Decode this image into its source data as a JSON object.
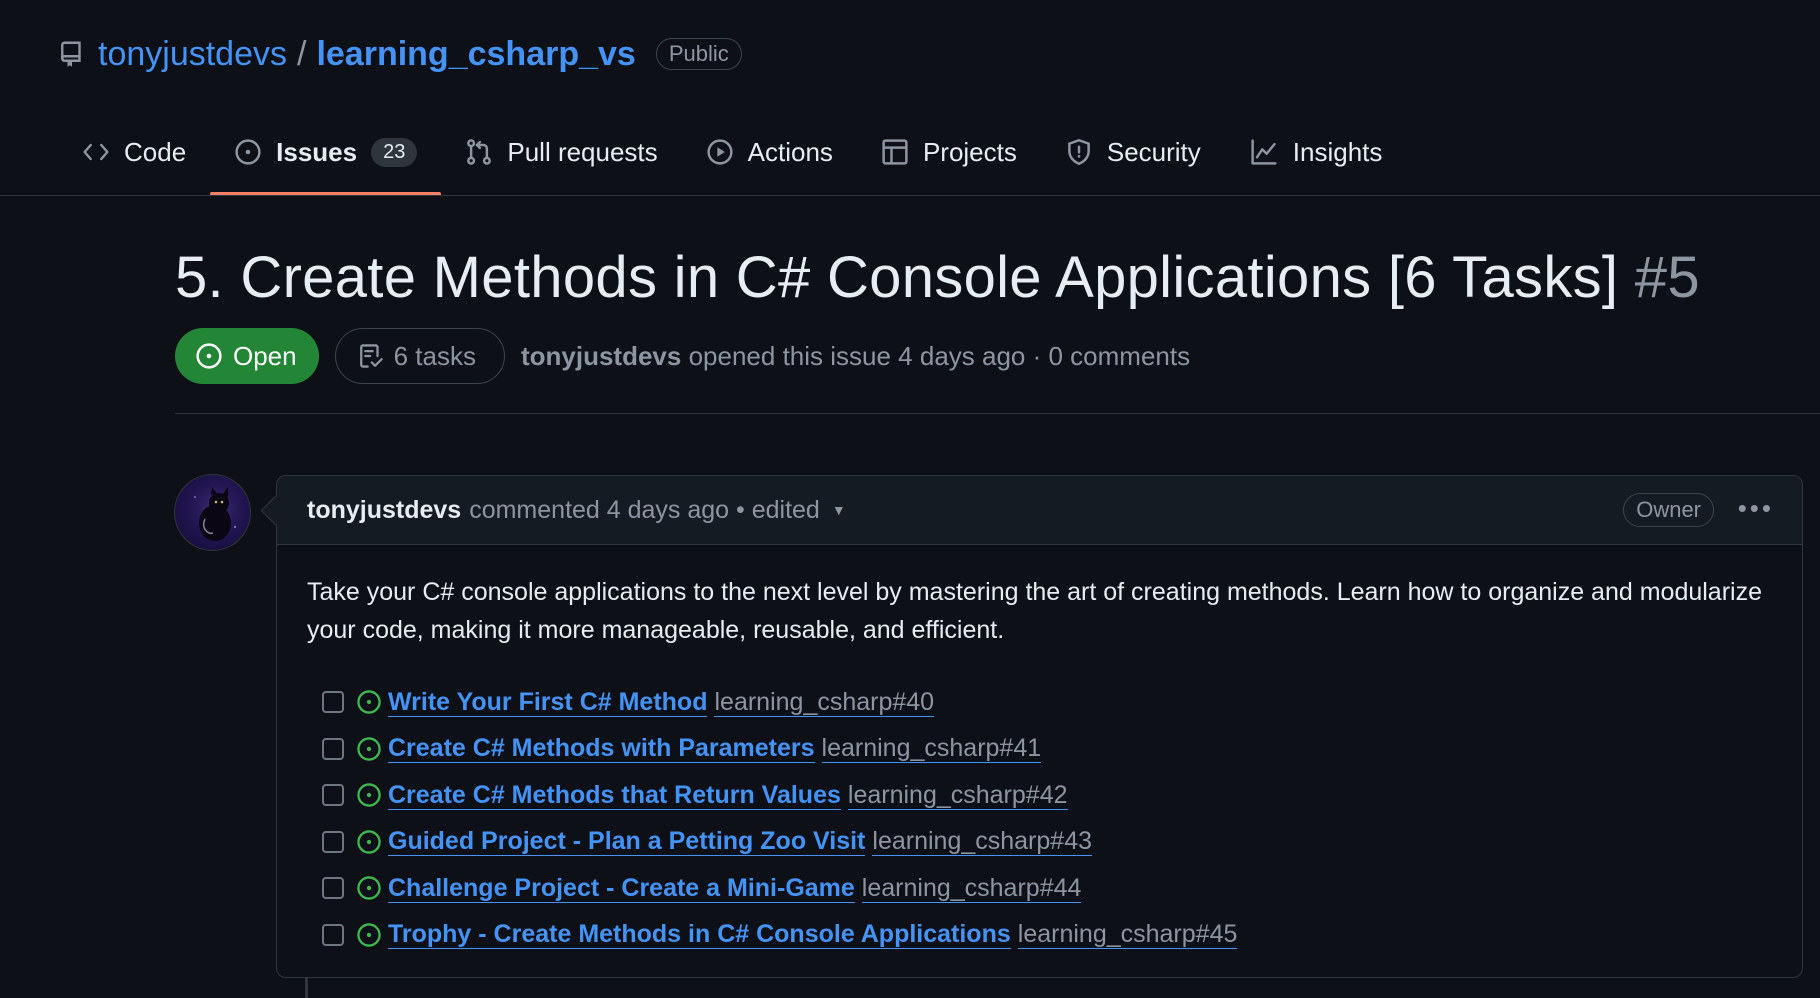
{
  "repo": {
    "owner": "tonyjustdevs",
    "separator": "/",
    "name": "learning_csharp_vs",
    "visibility": "Public"
  },
  "tabs": [
    {
      "label": "Code",
      "icon": "code-icon"
    },
    {
      "label": "Issues",
      "icon": "issue-opened-icon",
      "count": "23",
      "active": true
    },
    {
      "label": "Pull requests",
      "icon": "git-pull-request-icon"
    },
    {
      "label": "Actions",
      "icon": "play-icon"
    },
    {
      "label": "Projects",
      "icon": "table-icon"
    },
    {
      "label": "Security",
      "icon": "shield-icon"
    },
    {
      "label": "Insights",
      "icon": "graph-icon"
    }
  ],
  "issue": {
    "title": "5. Create Methods in C# Console Applications [6 Tasks]",
    "number": "#5",
    "state": "Open",
    "tasks_summary": "6 tasks",
    "author": "tonyjustdevs",
    "opened_text": "opened this issue 4 days ago · 0 comments"
  },
  "comment": {
    "author": "tonyjustdevs",
    "meta": "commented 4 days ago • edited",
    "role_badge": "Owner",
    "more_label": "•••",
    "body": "Take your C# console applications to the next level by mastering the art of creating methods. Learn how to organize and modularize your code, making it more manageable, reusable, and efficient.",
    "tasks": [
      {
        "title": "Write Your First C# Method",
        "ref": "learning_csharp#40",
        "checked": false
      },
      {
        "title": "Create C# Methods with Parameters",
        "ref": "learning_csharp#41",
        "checked": false
      },
      {
        "title": "Create C# Methods that Return Values",
        "ref": "learning_csharp#42",
        "checked": false
      },
      {
        "title": "Guided Project - Plan a Petting Zoo Visit",
        "ref": "learning_csharp#43",
        "checked": false
      },
      {
        "title": "Challenge Project - Create a Mini-Game",
        "ref": "learning_csharp#44",
        "checked": false
      },
      {
        "title": "Trophy - Create Methods in C# Console Applications",
        "ref": "learning_csharp#45",
        "checked": false
      }
    ]
  },
  "colors": {
    "background": "#0d1117",
    "link": "#4493f8",
    "open_green": "#238636",
    "open_icon_green": "#3fb950",
    "active_tab_underline": "#f78166",
    "muted": "#8d96a0"
  }
}
